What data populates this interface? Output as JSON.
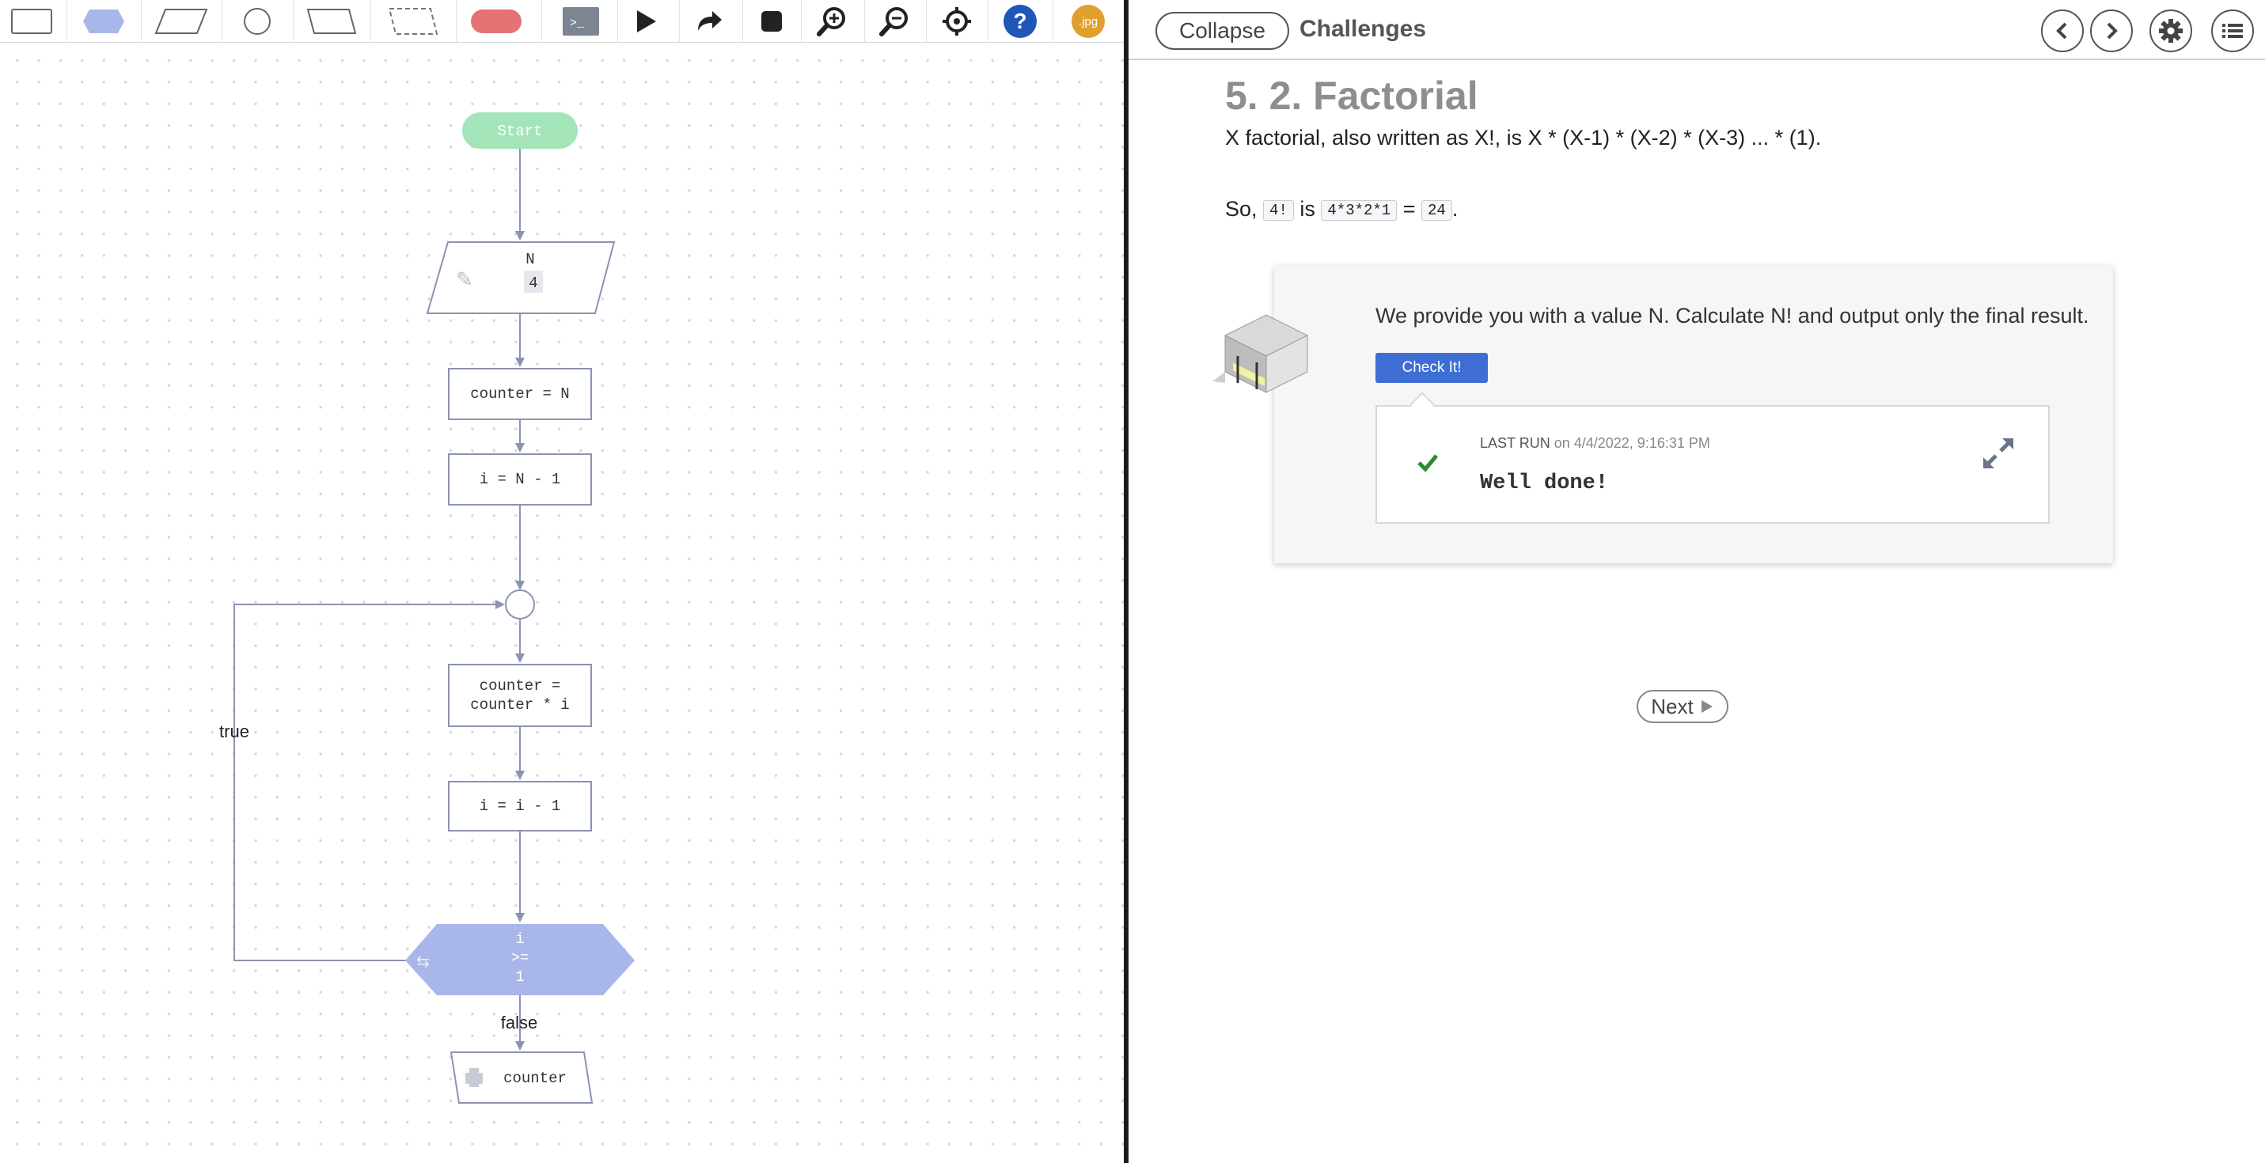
{
  "toolbar": {
    "items": [
      {
        "name": "rectangle-shape-tool",
        "icon": "rectangle-icon"
      },
      {
        "name": "hexagon-shape-tool",
        "icon": "hexagon-icon"
      },
      {
        "name": "parallelogram-shape-tool",
        "icon": "parallelogram-icon"
      },
      {
        "name": "circle-shape-tool",
        "icon": "circle-icon"
      },
      {
        "name": "trapezoid-shape-tool",
        "icon": "trapezoid-icon"
      },
      {
        "name": "dashed-trapezoid-shape-tool",
        "icon": "dashed-trapezoid-icon"
      },
      {
        "name": "terminator-shape-tool",
        "icon": "rounded-pill-icon"
      },
      {
        "name": "console-button",
        "icon": "terminal-icon"
      },
      {
        "name": "run-button",
        "icon": "play-icon"
      },
      {
        "name": "step-button",
        "icon": "redo-arrow-icon"
      },
      {
        "name": "stop-button",
        "icon": "stop-icon"
      },
      {
        "name": "zoom-in-button",
        "icon": "zoom-in-icon"
      },
      {
        "name": "zoom-out-button",
        "icon": "zoom-out-icon"
      },
      {
        "name": "center-button",
        "icon": "crosshair-icon"
      },
      {
        "name": "help-button",
        "icon": "help-icon"
      },
      {
        "name": "export-jpg-button",
        "icon": "jpg-export-icon"
      }
    ],
    "terminal_glyph": ">_",
    "help_glyph": "?",
    "jpg_label": ".jpg",
    "colors": {
      "hexagon": "#a9b6e9",
      "pill": "#e57373",
      "help": "#1f56b8",
      "jpg": "#e0a030",
      "terminal_bg": "#7d8593"
    }
  },
  "flowchart": {
    "start": "Start",
    "input": {
      "variable": "N",
      "value": "4"
    },
    "assign1": "counter = N",
    "assign2": "i = N - 1",
    "assign3_line1": "counter =",
    "assign3_line2": "counter * i",
    "assign4": "i = i - 1",
    "condition_line1": "i",
    "condition_line2": ">=",
    "condition_line3": "1",
    "true_label": "true",
    "false_label": "false",
    "output": "counter",
    "colors": {
      "start": "#a3e4b9",
      "decision": "#a9b6e9",
      "edge": "#8b93b3"
    }
  },
  "header": {
    "collapse_label": "Collapse",
    "title": "Challenges",
    "buttons": [
      "chevron-left-icon",
      "chevron-right-icon",
      "gear-icon",
      "list-icon"
    ]
  },
  "challenge": {
    "title": "5. 2. Factorial",
    "description": "X factorial, also written as X!, is X * (X-1) * (X-2) * (X-3) ... * (1).",
    "example_prefix": "So,",
    "example_code1": "4!",
    "example_is": "is",
    "example_code2": "4*3*2*1",
    "example_eq": "=",
    "example_code3": "24",
    "example_end": "."
  },
  "card": {
    "task": "We provide you with a value N. Calculate N! and output only the final result.",
    "check_label": "Check It!",
    "last_run_label": "Last Run",
    "last_run_date": "on 4/4/2022, 9:16:31 PM",
    "result_message": "Well done!",
    "colors": {
      "check": "#2e8b2e",
      "button": "#3e6ed4"
    }
  },
  "next_label": "Next"
}
